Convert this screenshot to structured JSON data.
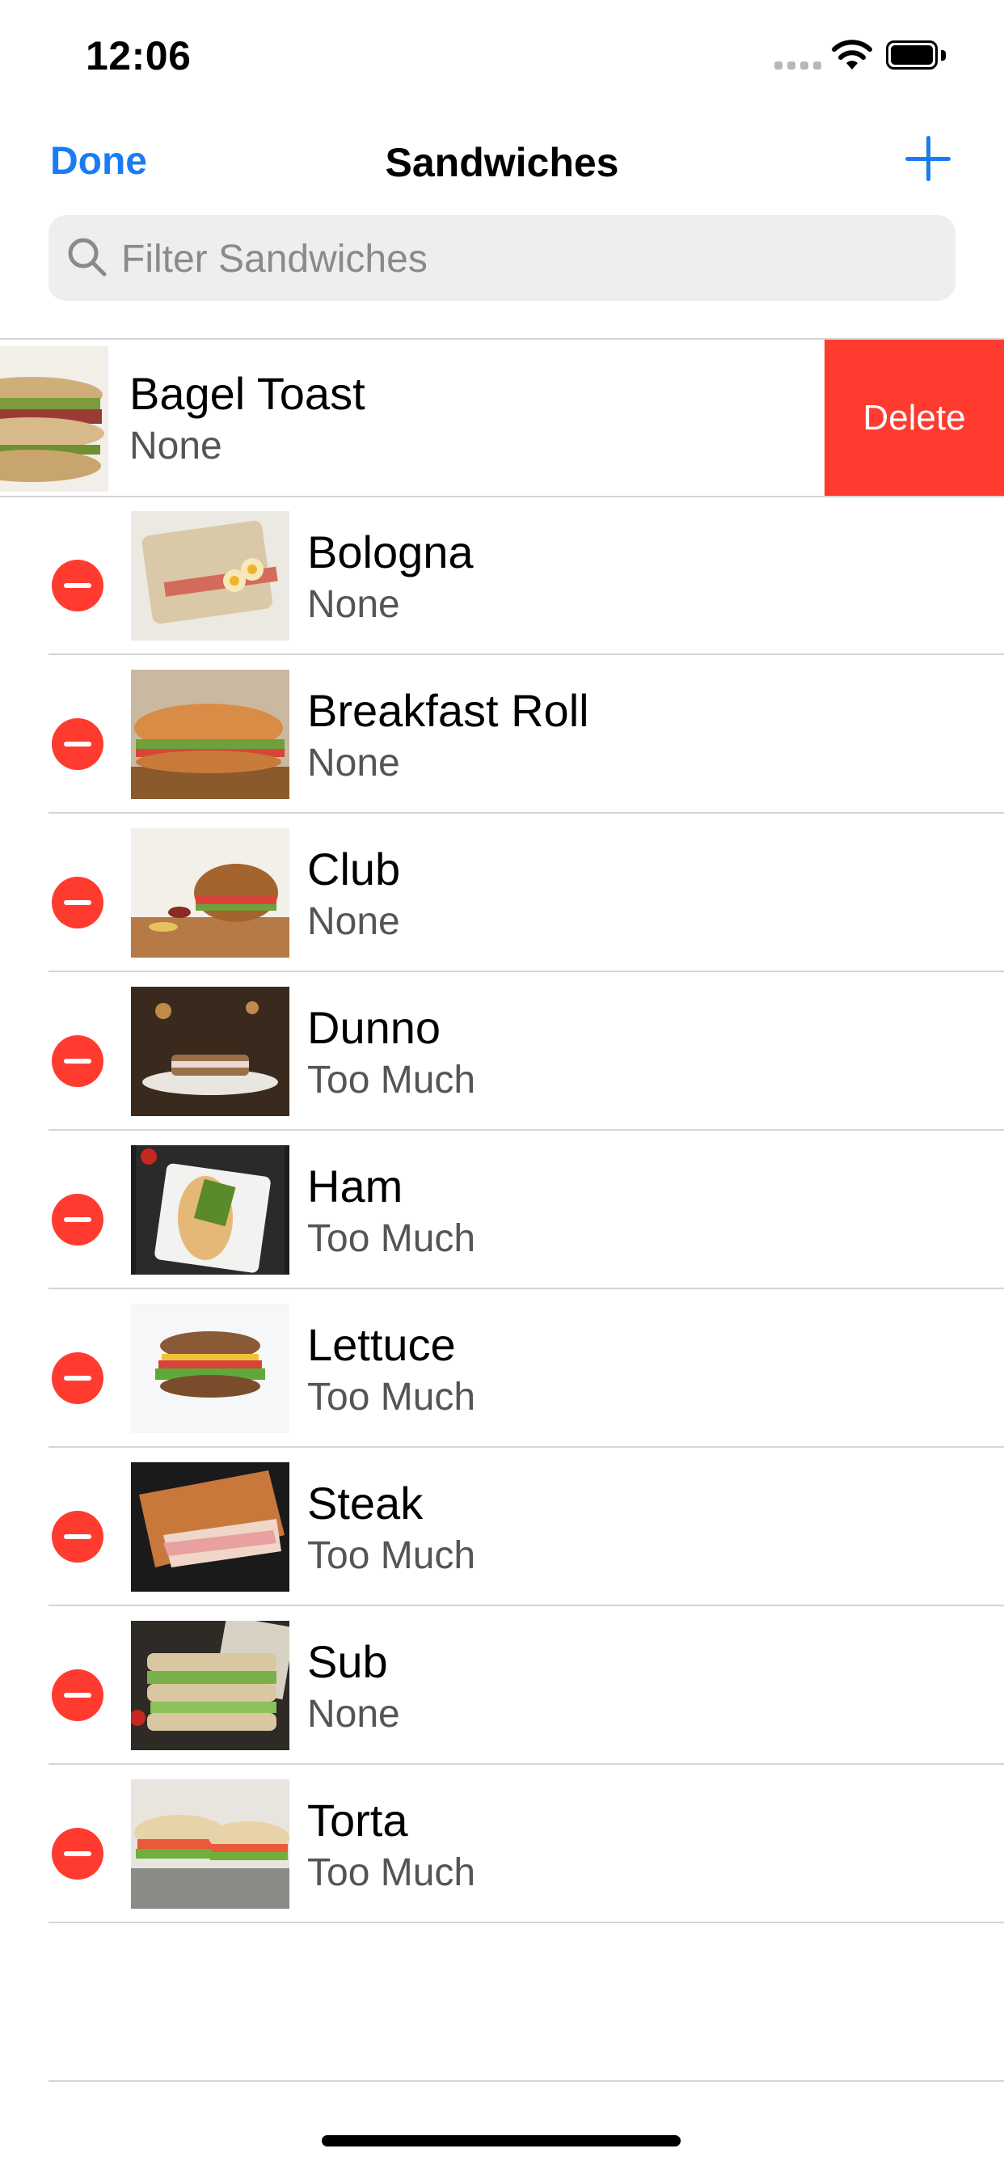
{
  "status_bar": {
    "time": "12:06"
  },
  "nav": {
    "done_label": "Done",
    "title": "Sandwiches"
  },
  "search": {
    "placeholder": "Filter Sandwiches",
    "value": ""
  },
  "swiped_item": {
    "name": "Bagel Toast",
    "subtitle": "None",
    "delete_label": "Delete"
  },
  "items": [
    {
      "name": "Bologna",
      "subtitle": "None"
    },
    {
      "name": "Breakfast Roll",
      "subtitle": "None"
    },
    {
      "name": "Club",
      "subtitle": "None"
    },
    {
      "name": "Dunno",
      "subtitle": "Too Much"
    },
    {
      "name": "Ham",
      "subtitle": "Too Much"
    },
    {
      "name": "Lettuce",
      "subtitle": "Too Much"
    },
    {
      "name": "Steak",
      "subtitle": "Too Much"
    },
    {
      "name": "Sub",
      "subtitle": "None"
    },
    {
      "name": "Torta",
      "subtitle": "Too Much"
    }
  ],
  "colors": {
    "accent": "#1a7cf5",
    "destructive": "#ff3b30"
  }
}
